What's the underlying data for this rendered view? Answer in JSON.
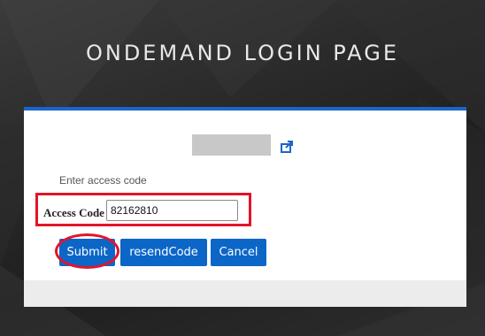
{
  "page": {
    "title": "ONDEMAND LOGIN PAGE"
  },
  "card": {
    "accent_color": "#1a66c9",
    "instruction": "Enter access code",
    "access_code_label": "Access Code",
    "access_code_value": "82162810",
    "external_link_icon": "external-link-icon"
  },
  "buttons": {
    "submit_label": "Submit",
    "resend_label": "resendCode",
    "cancel_label": "Cancel",
    "color": "#0b66c8"
  },
  "annotations": {
    "highlight_color": "#e3142a"
  }
}
